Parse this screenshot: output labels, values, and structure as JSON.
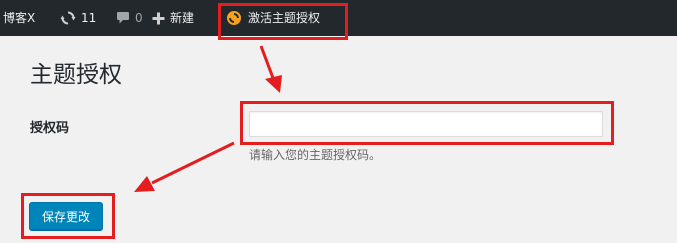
{
  "admin_bar": {
    "site_name": "博客X",
    "updates_icon": "refresh-icon",
    "updates_count": "11",
    "comments_icon": "comment-bubble-icon",
    "comments_count": "0",
    "new_icon": "plus-icon",
    "new_label": "新建",
    "activate_icon": "theme-refresh-icon",
    "activate_label": "激活主题授权"
  },
  "main": {
    "title": "主题授权",
    "license_field": {
      "label": "授权码",
      "value": "",
      "help_text": "请输入您的主题授权码。"
    },
    "save_label": "保存更改"
  },
  "colors": {
    "admin_bar_bg": "#23282d",
    "page_bg": "#f1f1f1",
    "button_primary": "#0085ba",
    "annotation_red": "#e41e1e",
    "activate_icon_orange": "#f7a21b"
  }
}
